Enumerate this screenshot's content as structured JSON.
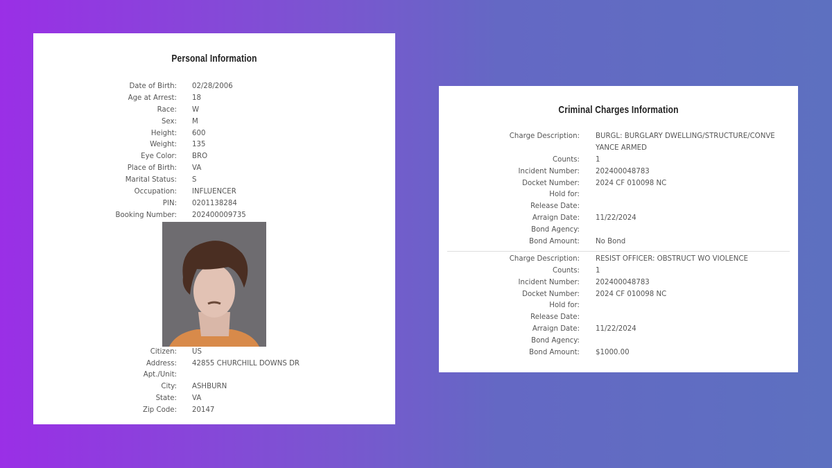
{
  "personal": {
    "title": "Personal Information",
    "fields": [
      {
        "label": "Date of Birth:",
        "value": "02/28/2006"
      },
      {
        "label": "Age at Arrest:",
        "value": "18"
      },
      {
        "label": "Race:",
        "value": "W"
      },
      {
        "label": "Sex:",
        "value": "M"
      },
      {
        "label": "Height:",
        "value": "600"
      },
      {
        "label": "Weight:",
        "value": "135"
      },
      {
        "label": "Eye Color:",
        "value": "BRO"
      },
      {
        "label": "Place of Birth:",
        "value": "VA"
      },
      {
        "label": "Marital Status:",
        "value": "S"
      },
      {
        "label": "Occupation:",
        "value": "INFLUENCER"
      },
      {
        "label": "PIN:",
        "value": "0201138284"
      },
      {
        "label": "Booking Number:",
        "value": "202400009735"
      }
    ],
    "fields_after_photo": [
      {
        "label": "Citizen:",
        "value": "US"
      },
      {
        "label": "Address:",
        "value": "42855 CHURCHILL DOWNS DR"
      },
      {
        "label": "Apt./Unit:",
        "value": ""
      },
      {
        "label": "City:",
        "value": "ASHBURN"
      },
      {
        "label": "State:",
        "value": "VA"
      },
      {
        "label": "Zip Code:",
        "value": "20147"
      }
    ]
  },
  "charges": {
    "title": "Criminal Charges Information",
    "items": [
      [
        {
          "label": "Charge Description:",
          "value": "BURGL: BURGLARY DWELLING/STRUCTURE/CONVEYANCE ARMED"
        },
        {
          "label": "Counts:",
          "value": "1"
        },
        {
          "label": "Incident Number:",
          "value": "202400048783"
        },
        {
          "label": "Docket Number:",
          "value": "2024 CF 010098 NC"
        },
        {
          "label": "Hold for:",
          "value": ""
        },
        {
          "label": "Release Date:",
          "value": ""
        },
        {
          "label": "Arraign Date:",
          "value": "11/22/2024"
        },
        {
          "label": "Bond Agency:",
          "value": ""
        },
        {
          "label": "Bond Amount:",
          "value": "No Bond"
        }
      ],
      [
        {
          "label": "Charge Description:",
          "value": "RESIST OFFICER: OBSTRUCT WO VIOLENCE"
        },
        {
          "label": "Counts:",
          "value": "1"
        },
        {
          "label": "Incident Number:",
          "value": "202400048783"
        },
        {
          "label": "Docket Number:",
          "value": "2024 CF 010098 NC"
        },
        {
          "label": "Hold for:",
          "value": ""
        },
        {
          "label": "Release Date:",
          "value": ""
        },
        {
          "label": "Arraign Date:",
          "value": "11/22/2024"
        },
        {
          "label": "Bond Agency:",
          "value": ""
        },
        {
          "label": "Bond Amount:",
          "value": "$1000.00"
        }
      ]
    ]
  }
}
